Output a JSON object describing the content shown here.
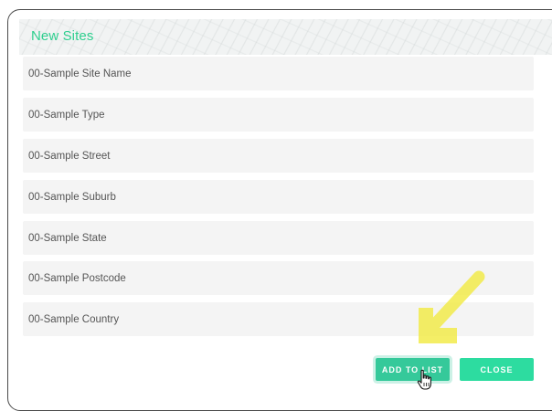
{
  "dialog": {
    "title": "New Sites"
  },
  "fields": [
    {
      "name": "site-name",
      "value": "00-Sample Site Name"
    },
    {
      "name": "type",
      "value": "00-Sample Type"
    },
    {
      "name": "street",
      "value": "00-Sample Street"
    },
    {
      "name": "suburb",
      "value": "00-Sample Suburb"
    },
    {
      "name": "state",
      "value": "00-Sample State"
    },
    {
      "name": "postcode",
      "value": "00-Sample Postcode"
    },
    {
      "name": "country",
      "value": "00-Sample Country"
    }
  ],
  "buttons": {
    "add_label": "ADD TO LIST",
    "close_label": "CLOSE"
  },
  "colors": {
    "accent": "#2ddca0",
    "title": "#2fcf8f",
    "annotation": "#f2ea3c"
  },
  "icons": {
    "annotation": "arrow-down-left-icon",
    "cursor": "hand-pointer-icon"
  }
}
